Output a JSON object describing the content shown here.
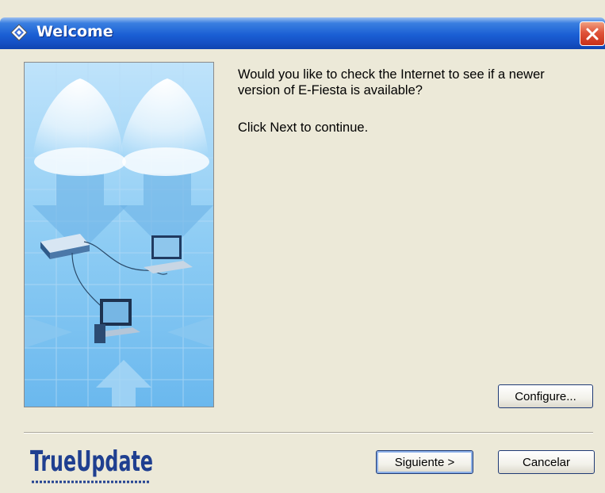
{
  "window": {
    "title": "Welcome"
  },
  "content": {
    "line1": "Would you like to check the Internet to see if a newer",
    "line2": "version of E-Fiesta is available?",
    "line3": "Click Next to continue."
  },
  "buttons": {
    "configure": "Configure...",
    "next": "Siguiente >",
    "cancel": "Cancelar"
  },
  "brand": {
    "logo_text_a": "True",
    "logo_text_b": "Update"
  },
  "icons": {
    "title": "diamond-app-icon",
    "close": "close-icon",
    "art": "network-illustration"
  },
  "colors": {
    "titlebar": "#1a5fd4",
    "dialog_bg": "#ece9d8",
    "close": "#e0543a",
    "logo": "#1f3f90"
  }
}
